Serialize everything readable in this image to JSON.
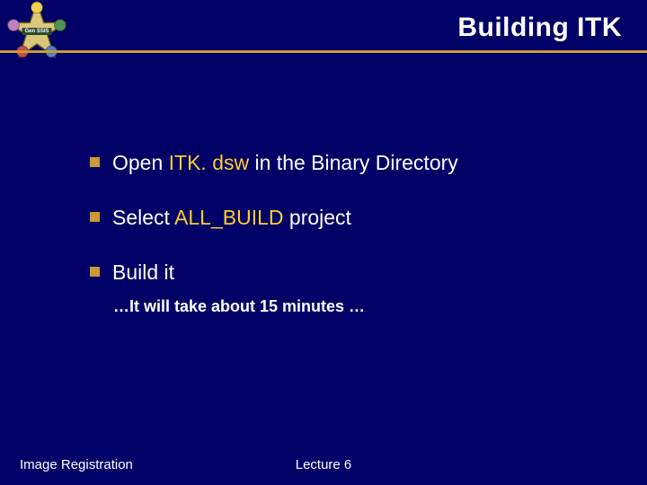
{
  "header": {
    "title": "Building ITK",
    "logo_label": "Gen SSIS"
  },
  "bullets": {
    "b1_pre": "Open   ",
    "b1_hl": "ITK. dsw",
    "b1_post": "   in the Binary Directory",
    "b2_pre": "Select ",
    "b2_hl": "ALL_BUILD",
    "b2_post": " project",
    "b3": "Build it",
    "b3_sub": "…It will take about 15 minutes …"
  },
  "footer": {
    "left": "Image Registration",
    "center": "Lecture 6"
  }
}
